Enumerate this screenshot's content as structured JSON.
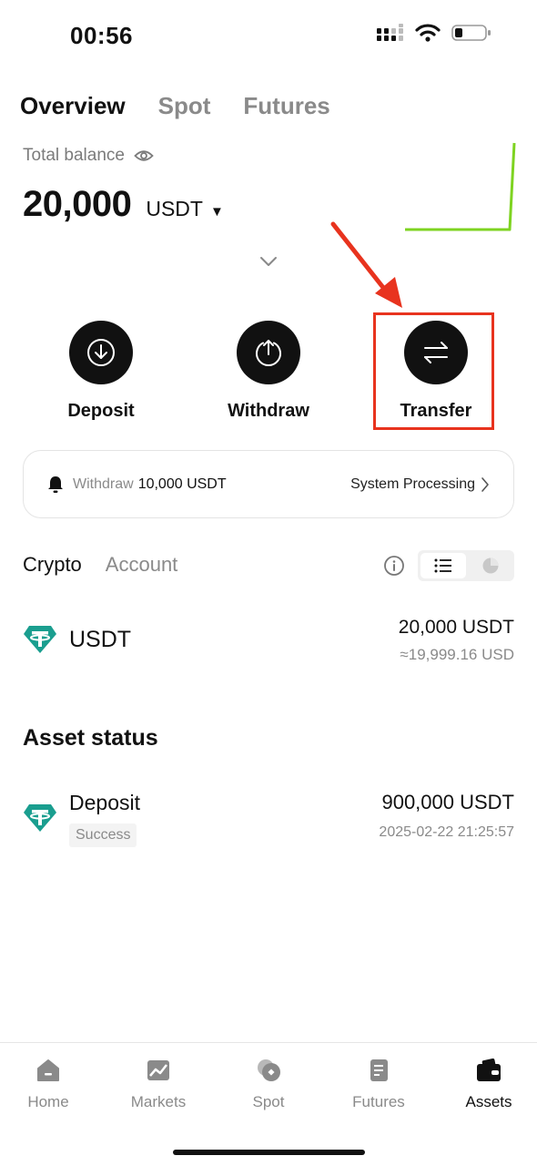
{
  "status_bar": {
    "time": "00:56"
  },
  "top_tabs": [
    {
      "label": "Overview",
      "active": true
    },
    {
      "label": "Spot",
      "active": false
    },
    {
      "label": "Futures",
      "active": false
    }
  ],
  "balance": {
    "label": "Total balance",
    "amount": "20,000",
    "unit": "USDT"
  },
  "actions": [
    {
      "label": "Deposit",
      "icon": "download-icon"
    },
    {
      "label": "Withdraw",
      "icon": "upload-icon"
    },
    {
      "label": "Transfer",
      "icon": "swap-arrows-icon"
    }
  ],
  "notice": {
    "prefix": "Withdraw",
    "amount": "10,000 USDT",
    "status": "System Processing"
  },
  "sub_tabs": [
    {
      "label": "Crypto",
      "active": true
    },
    {
      "label": "Account",
      "active": false
    }
  ],
  "assets": [
    {
      "symbol": "USDT",
      "amount": "20,000 USDT",
      "fiat": "≈19,999.16 USD"
    }
  ],
  "asset_status": {
    "title": "Asset status",
    "items": [
      {
        "type": "Deposit",
        "status": "Success",
        "amount": "900,000 USDT",
        "timestamp": "2025-02-22 21:25:57"
      }
    ]
  },
  "bottom_nav": [
    {
      "label": "Home",
      "icon": "home-icon",
      "active": false
    },
    {
      "label": "Markets",
      "icon": "chart-icon",
      "active": false
    },
    {
      "label": "Spot",
      "icon": "coins-icon",
      "active": false
    },
    {
      "label": "Futures",
      "icon": "document-icon",
      "active": false
    },
    {
      "label": "Assets",
      "icon": "wallet-icon",
      "active": true
    }
  ],
  "colors": {
    "accent_green": "#7ed321",
    "highlight_red": "#e8331e",
    "tether_teal": "#1a9e8f"
  }
}
